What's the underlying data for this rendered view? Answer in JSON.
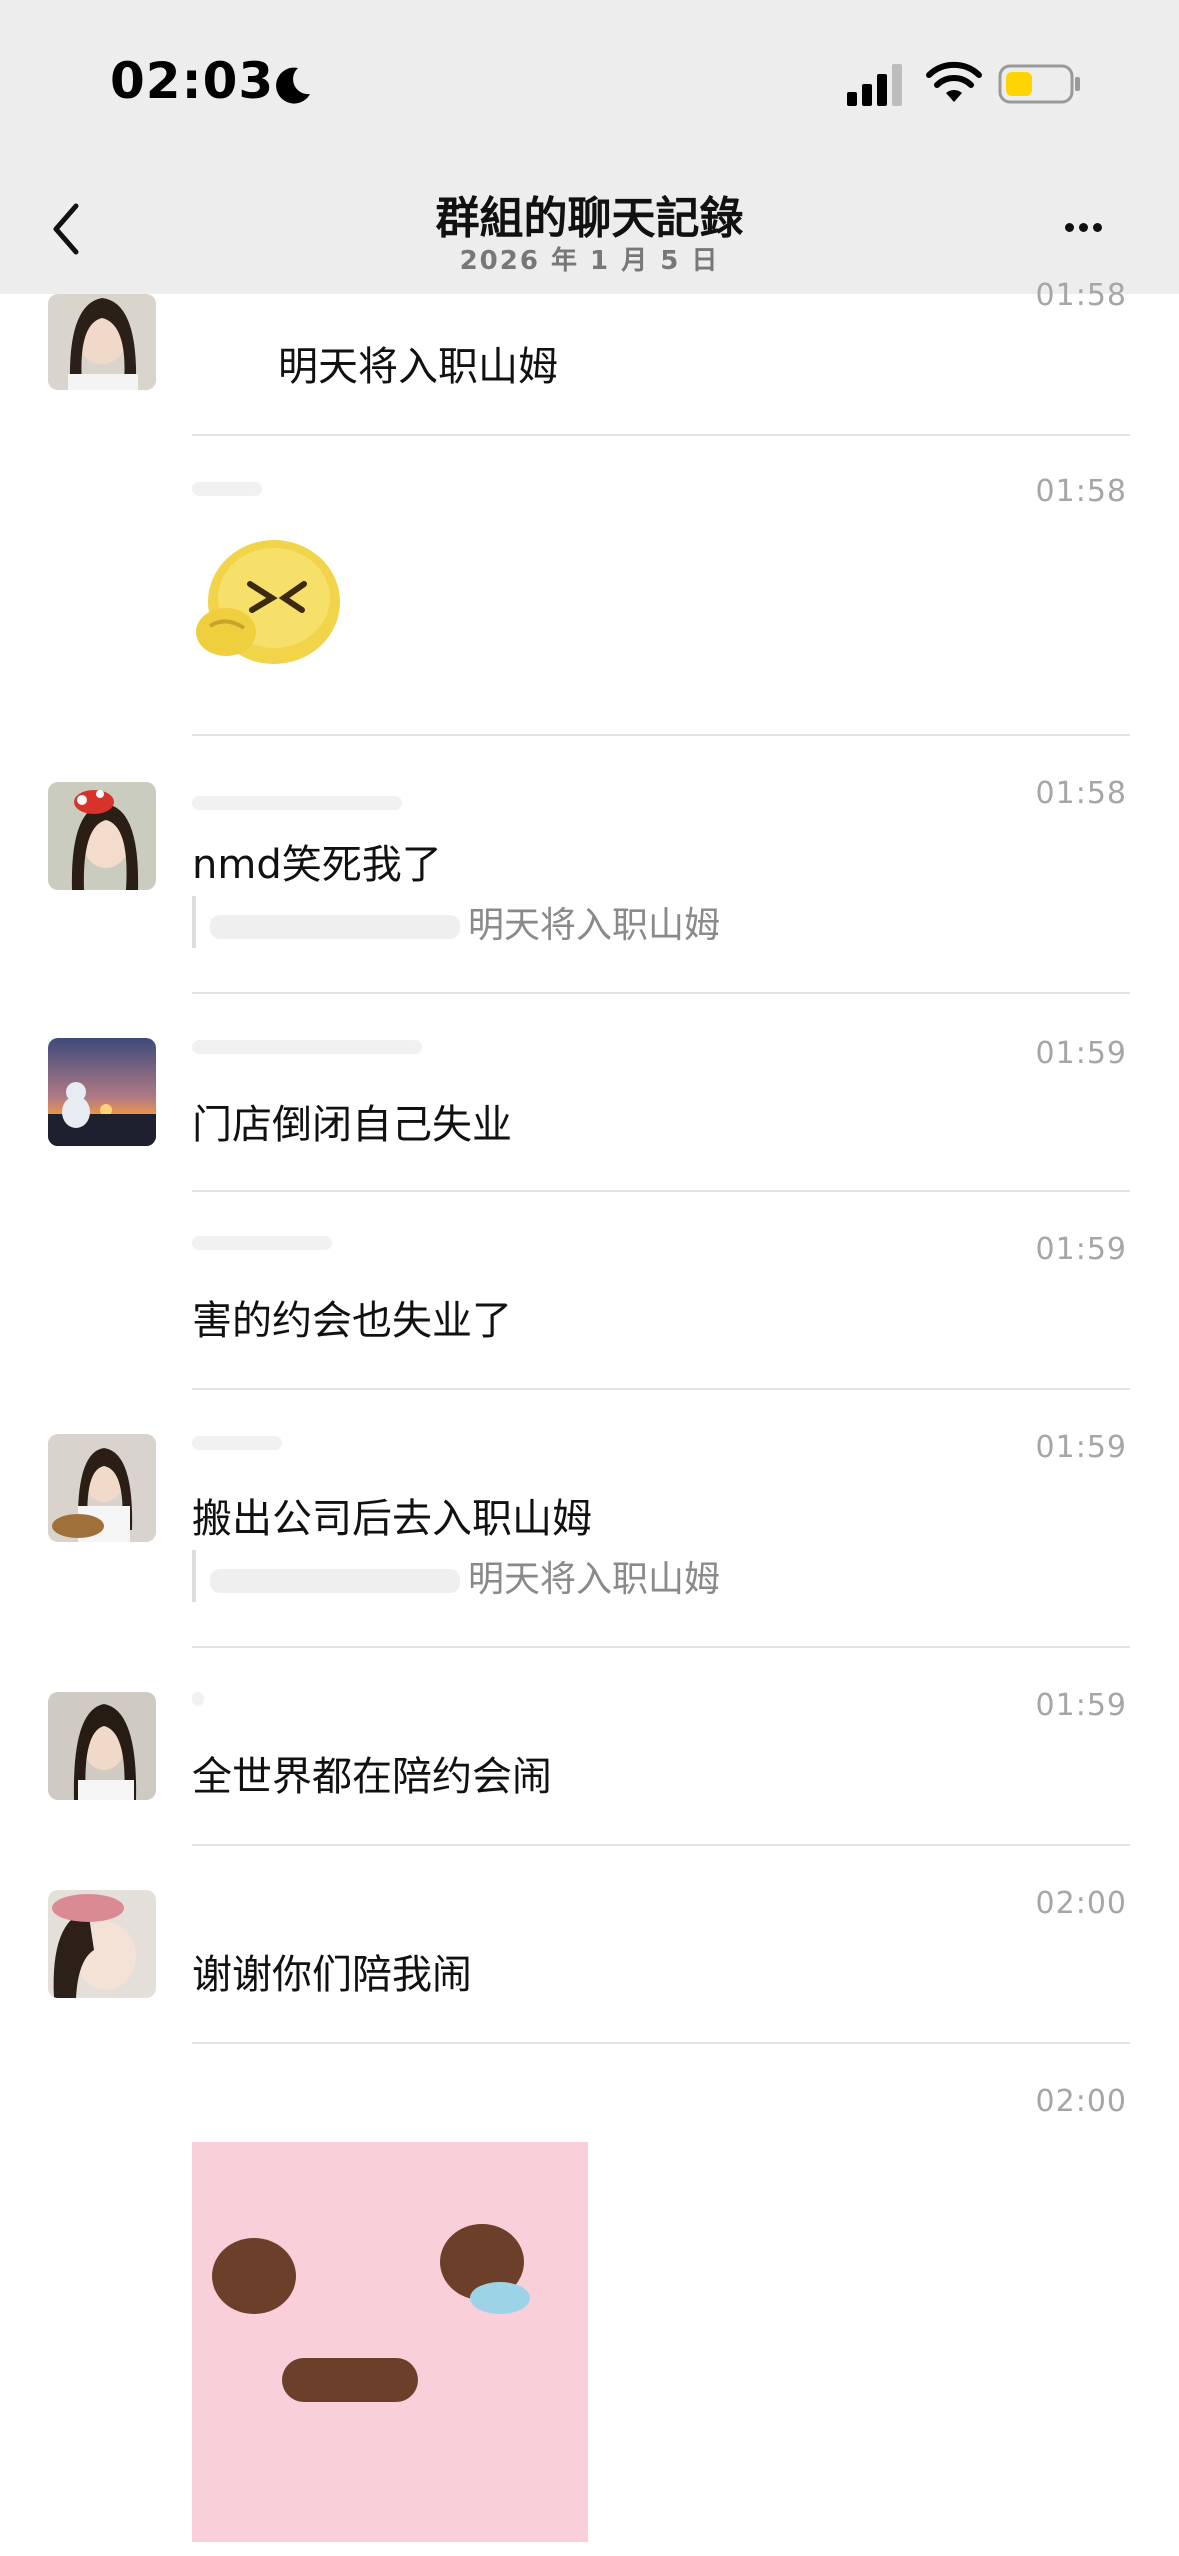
{
  "status_bar": {
    "time": "02:03",
    "icons": [
      "moon-icon",
      "cellular-signal-icon",
      "wifi-icon",
      "battery-icon"
    ],
    "battery_color": "#ffd400"
  },
  "nav": {
    "title": "群組的聊天記錄",
    "subtitle": "2026 年 1 月 5 日",
    "back_icon": "chevron-left-icon",
    "more_icon": "ellipsis-icon"
  },
  "messages": [
    {
      "time": "01:58",
      "text": "明天将入职山姆"
    },
    {
      "time": "01:58",
      "sticker": "crying-laughing-emoji-sticker"
    },
    {
      "time": "01:58",
      "text": "nmd笑死我了",
      "quote": "明天将入职山姆"
    },
    {
      "time": "01:59",
      "text": "门店倒闭自己失业"
    },
    {
      "time": "01:59",
      "text": "害的约会也失业了"
    },
    {
      "time": "01:59",
      "text": "搬出公司后去入职山姆",
      "quote": "明天将入职山姆"
    },
    {
      "time": "01:59",
      "text": "全世界都在陪约会闹"
    },
    {
      "time": "02:00",
      "text": "谢谢你们陪我闹"
    },
    {
      "time": "02:00",
      "sticker": "pink-teary-face-sticker"
    }
  ]
}
